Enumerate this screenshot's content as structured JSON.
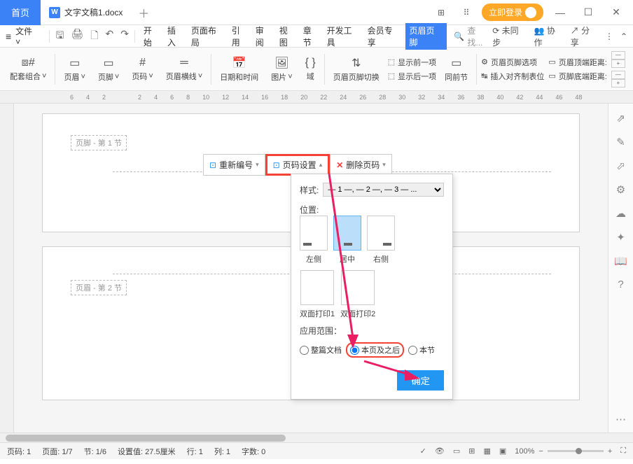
{
  "titlebar": {
    "home_tab": "首页",
    "doc_name": "文字文稿1.docx",
    "login": "立即登录"
  },
  "menubar": {
    "file": "文件",
    "items": [
      "开始",
      "插入",
      "页面布局",
      "引用",
      "审阅",
      "视图",
      "章节",
      "开发工具",
      "会员专享",
      "页眉页脚"
    ],
    "active_index": 9,
    "search_placeholder": "查找...",
    "right": {
      "unsync": "未同步",
      "collab": "协作",
      "share": "分享"
    }
  },
  "ribbon": {
    "groups": {
      "combo": "配套组合",
      "header": "页眉",
      "footer": "页脚",
      "pagenum": "页码",
      "line": "页眉横线",
      "datetime": "日期和时间",
      "image": "图片",
      "field": "域",
      "switch": "页眉页脚切换",
      "show_prev": "显示前一项",
      "show_next": "显示后一项",
      "same_section": "同前节",
      "pagenum_options": "页眉页脚选项",
      "align_tabs": "插入对齐制表位",
      "top_dist": "页眉顶端距离:",
      "bot_dist": "页脚底端距离:"
    }
  },
  "ruler": [
    "6",
    "4",
    "2",
    "2",
    "4",
    "6",
    "8",
    "10",
    "12",
    "14",
    "16",
    "18",
    "20",
    "22",
    "24",
    "26",
    "28",
    "30",
    "32",
    "34",
    "36",
    "38",
    "40",
    "42",
    "44",
    "46",
    "48"
  ],
  "canvas": {
    "section1_label": "页脚 - 第 1 节",
    "section2_label": "页眉 - 第 2 节"
  },
  "mini_toolbar": {
    "renumber": "重新编号",
    "page_settings": "页码设置",
    "delete_pagenum": "删除页码"
  },
  "popup": {
    "style_label": "样式:",
    "style_value": "— 1 —, — 2 —, — 3 — ...",
    "position_label": "位置:",
    "positions": {
      "left": "左侧",
      "center": "居中",
      "right": "右侧"
    },
    "selected_position": "center",
    "duplex1": "双面打印1",
    "duplex2": "双面打印2",
    "scope_label": "应用范围：",
    "scope_options": {
      "whole": "整篇文档",
      "from_here": "本页及之后",
      "this_section": "本节"
    },
    "selected_scope": "from_here",
    "ok": "确定"
  },
  "statusbar": {
    "page_num": "页码: 1",
    "page": "页面: 1/7",
    "section": "节: 1/6",
    "pos": "设置值: 27.5厘米",
    "line": "行: 1",
    "col": "列: 1",
    "char_count": "字数: 0",
    "zoom": "100%"
  }
}
